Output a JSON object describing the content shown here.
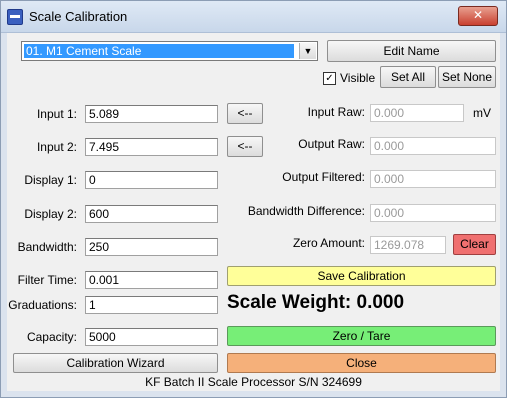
{
  "window": {
    "title": "Scale Calibration",
    "close_glyph": "✕"
  },
  "scale_select": {
    "selected": "01. M1 Cement Scale",
    "arrow_glyph": "▼"
  },
  "top_buttons": {
    "edit_name": "Edit Name",
    "visible_label": "Visible",
    "visible_checked": true,
    "check_glyph": "✓",
    "set_all": "Set All",
    "set_none": "Set None"
  },
  "left_fields": {
    "input1_label": "Input 1:",
    "input1_value": "5.089",
    "input2_label": "Input 2:",
    "input2_value": "7.495",
    "display1_label": "Display 1:",
    "display1_value": "0",
    "display2_label": "Display 2:",
    "display2_value": "600",
    "bandwidth_label": "Bandwidth:",
    "bandwidth_value": "250",
    "filter_time_label": "Filter Time:",
    "filter_time_value": "0.001",
    "graduations_label": "Graduations:",
    "graduations_value": "1",
    "capacity_label": "Capacity:",
    "capacity_value": "5000"
  },
  "arrow_buttons": {
    "copy1": "<--",
    "copy2": "<--"
  },
  "right_fields": {
    "input_raw_label": "Input Raw:",
    "input_raw_value": "0.000",
    "input_raw_unit": "mV",
    "output_raw_label": "Output Raw:",
    "output_raw_value": "0.000",
    "output_filtered_label": "Output Filtered:",
    "output_filtered_value": "0.000",
    "bandwidth_diff_label": "Bandwidth Difference:",
    "bandwidth_diff_value": "0.000",
    "zero_amount_label": "Zero Amount:",
    "zero_amount_value": "1269.078",
    "clear_label": "Clear"
  },
  "actions": {
    "save_calibration": "Save Calibration",
    "scale_weight": "Scale Weight: 0.000",
    "zero_tare": "Zero / Tare",
    "calibration_wizard": "Calibration Wizard",
    "close": "Close"
  },
  "footer": {
    "status": "KF Batch II Scale Processor S/N 324699"
  },
  "colors": {
    "save_bg": "#ffff99",
    "zero_bg": "#77ee77",
    "close_bg": "#f5b07a",
    "clear_bg": "#f07070",
    "selection": "#3399ff"
  }
}
